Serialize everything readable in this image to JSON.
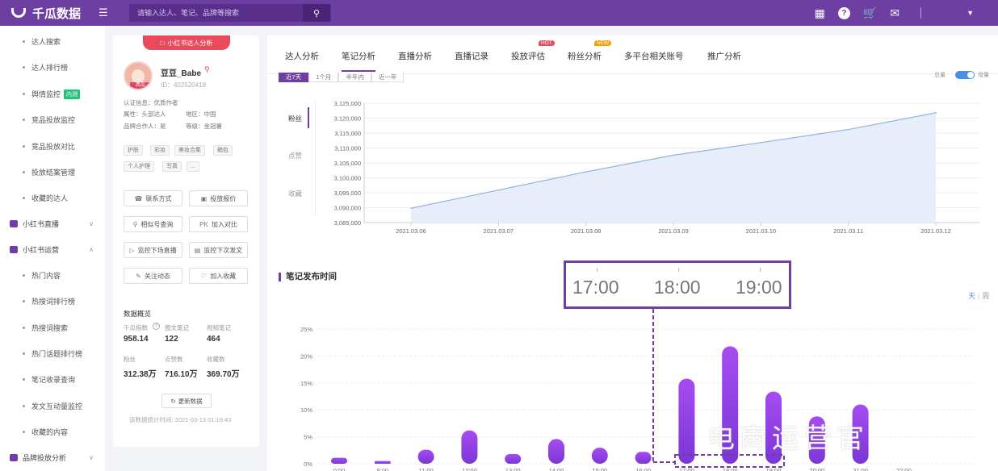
{
  "header": {
    "brand": "千瓜数据",
    "search_placeholder": "请输入达人、笔记、品牌等搜索",
    "icons": [
      "grid-icon",
      "help-icon",
      "cart-icon",
      "mail-icon",
      "dropdown-icon"
    ]
  },
  "sidebar": {
    "items": [
      {
        "label": "达人搜索"
      },
      {
        "label": "达人排行榜"
      },
      {
        "label": "舆情监控",
        "badge": "内测"
      },
      {
        "label": "竞品投放监控"
      },
      {
        "label": "竞品投放对比"
      },
      {
        "label": "投放结案管理"
      },
      {
        "label": "收藏的达人"
      }
    ],
    "groups": [
      {
        "label": "小红书直播"
      },
      {
        "label": "小红书运营"
      }
    ],
    "items2": [
      {
        "label": "热门内容"
      },
      {
        "label": "热搜词排行榜"
      },
      {
        "label": "热搜词搜索"
      },
      {
        "label": "热门话题排行榜"
      },
      {
        "label": "笔记收录查询"
      },
      {
        "label": "发文互动量监控"
      },
      {
        "label": "收藏的内容"
      }
    ],
    "group3": {
      "label": "品牌投放分析"
    }
  },
  "profile": {
    "tab_label": "小红书达人分析",
    "avatar_tag": "西瓜",
    "name": "豆豆_Babe",
    "id": "ID：422520418",
    "cert": "认证信息：优质作者",
    "attr": "属性：头部达人",
    "region": "地区：中国",
    "brand_coop": "品牌合作人：是",
    "level": "等级：金冠薯",
    "tags": [
      "护肤",
      "彩妆",
      "美妆合集",
      "箱包",
      "个人护理",
      "写真",
      "..."
    ],
    "buttons": [
      {
        "label": "联系方式",
        "icon": "phone-icon"
      },
      {
        "label": "投放报价",
        "icon": "quote-icon"
      },
      {
        "label": "相似号查询",
        "icon": "search-icon"
      },
      {
        "label": "加入对比",
        "icon": "pk-icon",
        "prefix": "PK"
      },
      {
        "label": "监控下场直播",
        "icon": "live-icon"
      },
      {
        "label": "监控下次发文",
        "icon": "doc-icon"
      },
      {
        "label": "关注动态",
        "icon": "follow-icon"
      },
      {
        "label": "加入收藏",
        "icon": "heart-icon"
      }
    ],
    "overview_title": "数据概览",
    "stats": [
      {
        "label": "千瓜指数",
        "value": "958.14"
      },
      {
        "label": "图文笔记",
        "value": "122"
      },
      {
        "label": "视频笔记",
        "value": "464"
      },
      {
        "label": "粉丝",
        "value": "312.38万"
      },
      {
        "label": "点赞数",
        "value": "716.10万"
      },
      {
        "label": "收藏数",
        "value": "369.70万"
      }
    ],
    "refresh_label": "更新数据",
    "update_time": "该数据统计时间: 2021-03-13 01:16:43"
  },
  "main": {
    "tabs": [
      {
        "label": "达人分析"
      },
      {
        "label": "笔记分析"
      },
      {
        "label": "直播分析"
      },
      {
        "label": "直播记录"
      },
      {
        "label": "投放评估",
        "badge": "HOT"
      },
      {
        "label": "粉丝分析",
        "badge": "NEW"
      },
      {
        "label": "多平台相关账号"
      },
      {
        "label": "推广分析"
      }
    ],
    "active_tab": "笔记分析",
    "ranges": [
      "近7天",
      "1个月",
      "半年内",
      "近一年"
    ],
    "toggle_left": "总量",
    "toggle_right": "增量",
    "vtabs": [
      "粉丝",
      "点赞",
      "收藏"
    ],
    "section_title": "笔记发布时间",
    "day_label": "天",
    "week_label": "周",
    "zoom_labels": [
      "17:00",
      "18:00",
      "19:00"
    ],
    "watermark": "电商运营官"
  },
  "chart_data": [
    {
      "type": "area",
      "x": [
        "2021.03.06",
        "2021.03.07",
        "2021.03.08",
        "2021.03.09",
        "2021.03.10",
        "2021.03.11",
        "2021.03.12"
      ],
      "values": [
        3089800,
        3095900,
        3102000,
        3107600,
        3111800,
        3116200,
        3121800
      ],
      "yticks": [
        "3,085,000",
        "3,090,000",
        "3,095,000",
        "3,100,000",
        "3,105,000",
        "3,110,000",
        "3,115,000",
        "3,120,000",
        "3,125,000"
      ],
      "ylim": [
        3085000,
        3125000
      ],
      "colors": {
        "line": "#8fb3e3",
        "fill": "#e7eefa"
      }
    },
    {
      "type": "bar",
      "categories": [
        "0:00",
        "9:00",
        "11:00",
        "12:00",
        "13:00",
        "14:00",
        "15:00",
        "16:00",
        "17:00",
        "18:00",
        "19:00",
        "20:00",
        "21:00",
        "22:00"
      ],
      "values": [
        1.1,
        0.5,
        2.6,
        6.2,
        1.8,
        4.6,
        3.0,
        2.2,
        15.8,
        21.8,
        13.4,
        8.8,
        11.0,
        0
      ],
      "yticks": [
        "0%",
        "5%",
        "10%",
        "15%",
        "20%",
        "25%"
      ],
      "ylim": [
        0,
        25
      ],
      "colors": {
        "bar_top": "#a64cf0",
        "bar_bottom": "#7b36d6"
      }
    }
  ]
}
